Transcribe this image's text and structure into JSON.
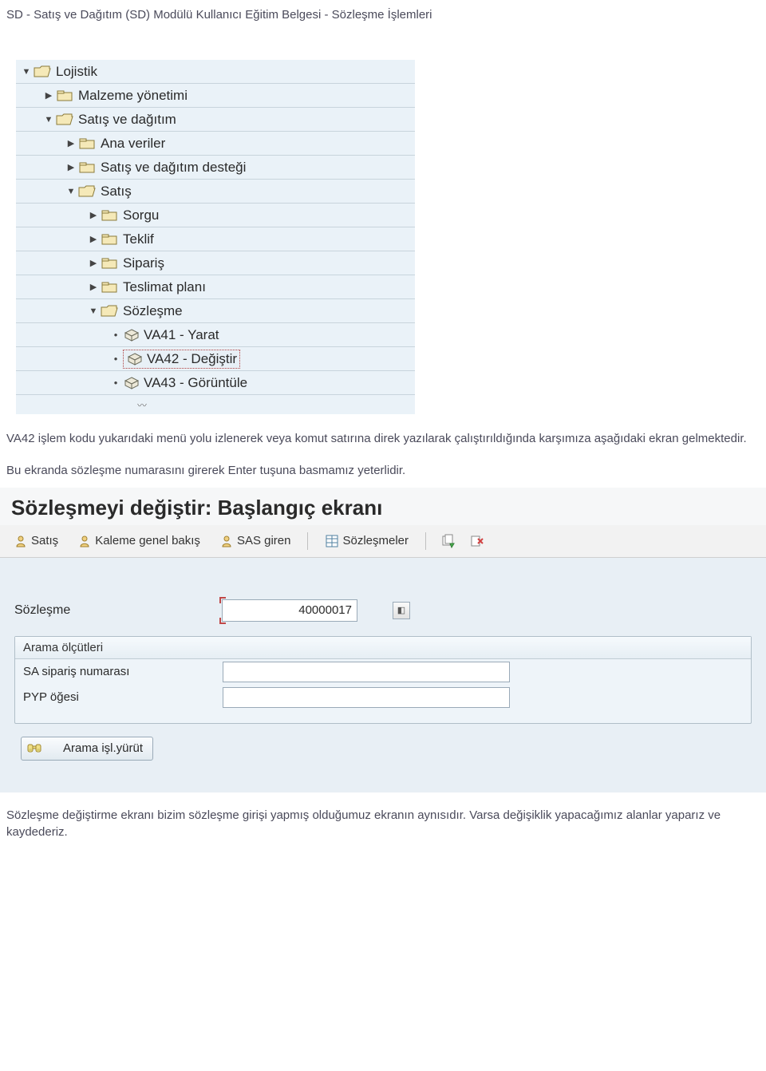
{
  "doc": {
    "header": "SD - Satış ve Dağıtım (SD) Modülü Kullanıcı Eğitim Belgesi - Sözleşme İşlemleri",
    "para1": "VA42 işlem kodu yukarıdaki menü yolu izlenerek veya komut satırına direk yazılarak çalıştırıldığında karşımıza aşağıdaki ekran gelmektedir.",
    "para2": "Bu ekranda sözleşme numarasını girerek Enter tuşuna basmamız yeterlidir.",
    "para3": "Sözleşme değiştirme ekranı bizim sözleşme girişi yapmış olduğumuz ekranın aynısıdır. Varsa değişiklik yapacağımız alanlar yaparız ve kaydederiz."
  },
  "tree": {
    "n0": "Lojistik",
    "n1": "Malzeme yönetimi",
    "n2": "Satış ve dağıtım",
    "n3": "Ana veriler",
    "n4": "Satış ve dağıtım desteği",
    "n5": "Satış",
    "n6": "Sorgu",
    "n7": "Teklif",
    "n8": "Sipariş",
    "n9": "Teslimat planı",
    "n10": "Sözleşme",
    "n11": "VA41 - Yarat",
    "n12": "VA42 - Değiştir",
    "n13": "VA43 - Görüntüle"
  },
  "screen": {
    "title": "Sözleşmeyi değiştir: Başlangıç ekranı",
    "toolbar": {
      "satis": "Satış",
      "kaleme": "Kaleme genel bakış",
      "sas": "SAS giren",
      "sozlesmeler": "Sözleşmeler"
    },
    "field": {
      "label": "Sözleşme",
      "value": "40000017"
    },
    "group": {
      "title": "Arama ölçütleri",
      "sa_label": "SA sipariş numarası",
      "sa_value": "",
      "pyp_label": "PYP öğesi",
      "pyp_value": ""
    },
    "exec_label": "Arama işl.yürüt"
  }
}
